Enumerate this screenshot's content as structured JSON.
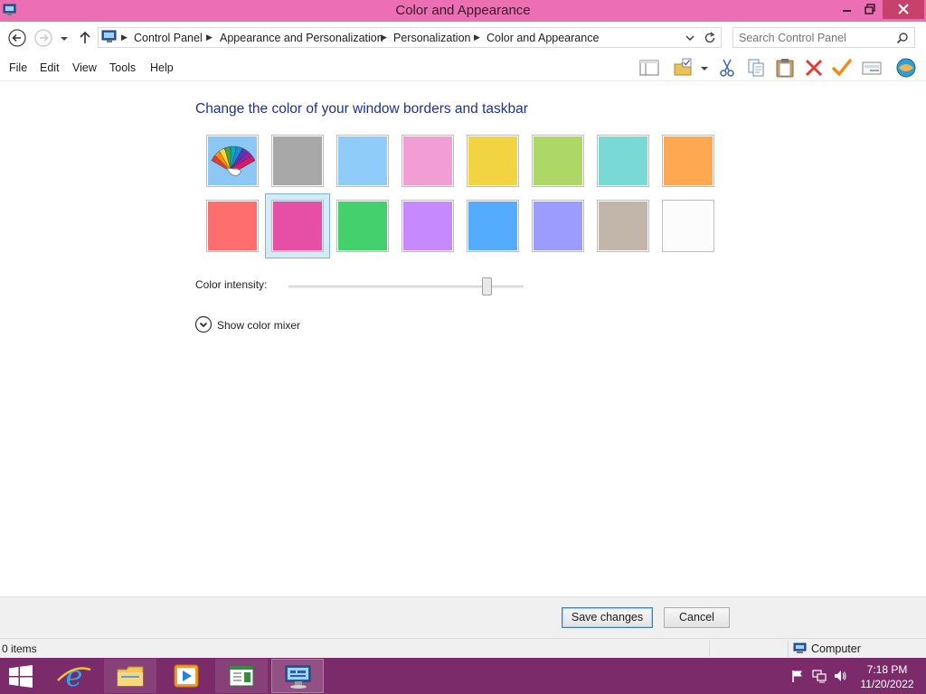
{
  "window": {
    "title": "Color and Appearance"
  },
  "address": {
    "breadcrumb": [
      "Control Panel",
      "Appearance and Personalization",
      "Personalization",
      "Color and Appearance"
    ],
    "search_placeholder": "Search Control Panel"
  },
  "menu": {
    "items": [
      "File",
      "Edit",
      "View",
      "Tools",
      "Help"
    ]
  },
  "content": {
    "heading": "Change the color of your window borders and taskbar",
    "swatches": [
      {
        "id": "automatic",
        "color": "#8cc8f5",
        "icon": "color-fan-icon"
      },
      {
        "id": "gray",
        "color": "#a8a8a8"
      },
      {
        "id": "light-blue",
        "color": "#8fccf9"
      },
      {
        "id": "pink",
        "color": "#f29ed5"
      },
      {
        "id": "yellow",
        "color": "#f2d443"
      },
      {
        "id": "lime",
        "color": "#add865"
      },
      {
        "id": "teal",
        "color": "#79dad5"
      },
      {
        "id": "orange",
        "color": "#fea952"
      },
      {
        "id": "red",
        "color": "#fe6e6e"
      },
      {
        "id": "magenta",
        "color": "#e64fa5",
        "selected": true
      },
      {
        "id": "green",
        "color": "#43d06d"
      },
      {
        "id": "violet",
        "color": "#c78afe"
      },
      {
        "id": "blue",
        "color": "#55acfe"
      },
      {
        "id": "periwinkle",
        "color": "#9c9bfe"
      },
      {
        "id": "taupe",
        "color": "#c2b6aa"
      },
      {
        "id": "white",
        "color": "#fcfcfc"
      }
    ],
    "intensity_label": "Color intensity:",
    "intensity_value": 0.86,
    "mixer_label": "Show color mixer"
  },
  "buttons": {
    "save": "Save changes",
    "cancel": "Cancel"
  },
  "status": {
    "items": "0 items",
    "location": "Computer"
  },
  "taskbar": {
    "time": "7:18 PM",
    "date": "11/20/2022",
    "accent": "#7b2b6a"
  },
  "colors": {
    "titlebar": "#ec6fb3",
    "heading": "#1e3287"
  }
}
